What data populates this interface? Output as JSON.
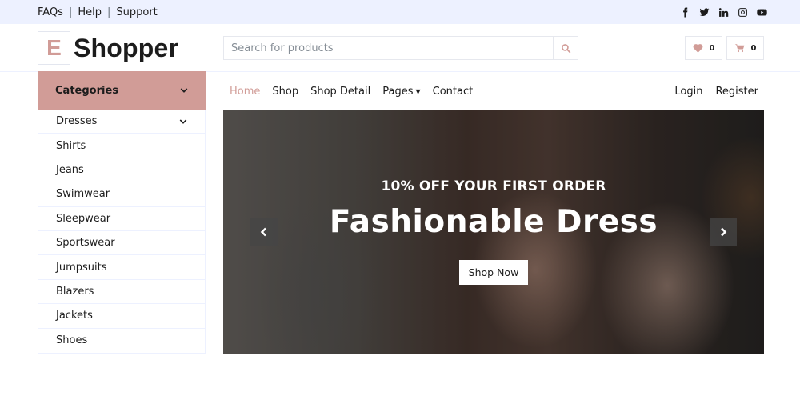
{
  "topbar": {
    "links": [
      "FAQs",
      "Help",
      "Support"
    ],
    "social": [
      "facebook-icon",
      "twitter-icon",
      "linkedin-icon",
      "instagram-icon",
      "youtube-icon"
    ]
  },
  "header": {
    "logo_letter": "E",
    "logo_text": "Shopper",
    "search_placeholder": "Search for products",
    "wishlist_count": "0",
    "cart_count": "0"
  },
  "categories": {
    "title": "Categories",
    "items": [
      "Dresses",
      "Shirts",
      "Jeans",
      "Swimwear",
      "Sleepwear",
      "Sportswear",
      "Jumpsuits",
      "Blazers",
      "Jackets",
      "Shoes"
    ]
  },
  "nav": {
    "items": [
      "Home",
      "Shop",
      "Shop Detail",
      "Pages",
      "Contact"
    ],
    "active": "Home",
    "login": "Login",
    "register": "Register"
  },
  "hero": {
    "subtitle": "10% OFF YOUR FIRST ORDER",
    "title": "Fashionable Dress",
    "button": "Shop Now"
  },
  "colors": {
    "accent": "#D19C97",
    "topbar_bg": "#EDF1FF",
    "text": "#1C1C1C"
  }
}
